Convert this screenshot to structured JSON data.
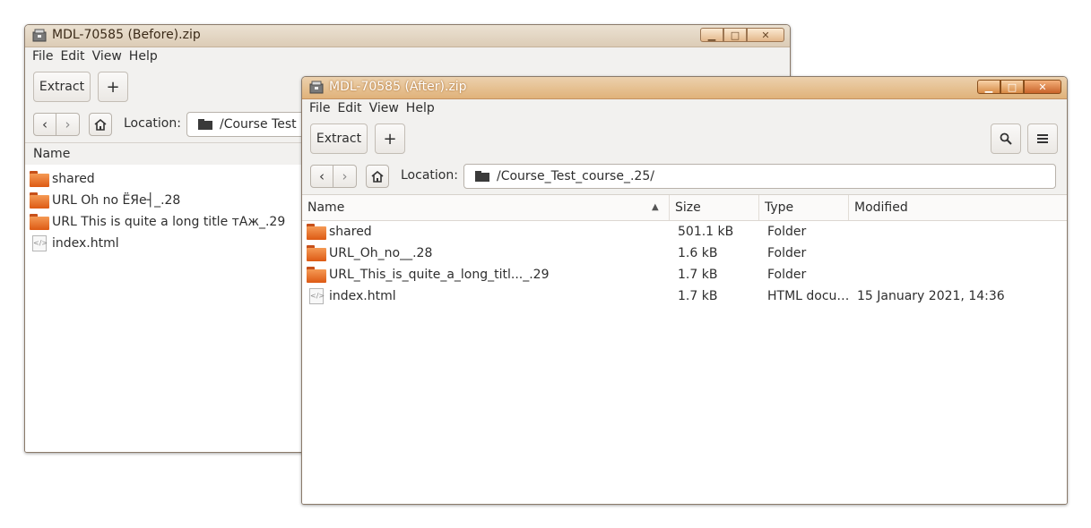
{
  "colors": {
    "accent": "#e0b27a",
    "folder": "#e0611c"
  },
  "before": {
    "title": "MDL-70585 (Before).zip",
    "menu": [
      "File",
      "Edit",
      "View",
      "Help"
    ],
    "extract_label": "Extract",
    "add_label": "+",
    "location_label": "Location:",
    "location_value": "/Course Test",
    "column_name": "Name",
    "rows": [
      {
        "name": "shared",
        "icon": "folder-icon"
      },
      {
        "name": "URL Oh no ЁЯе┤_.28",
        "icon": "folder-icon"
      },
      {
        "name": "URL This is quite a long title тАж_.29",
        "icon": "folder-icon"
      },
      {
        "name": "index.html",
        "icon": "html-file-icon"
      }
    ]
  },
  "after": {
    "title": "MDL-70585 (After).zip",
    "menu": [
      "File",
      "Edit",
      "View",
      "Help"
    ],
    "extract_label": "Extract",
    "add_label": "+",
    "location_label": "Location:",
    "location_value": "/Course_Test_course_.25/",
    "columns": {
      "name": "Name",
      "size": "Size",
      "type": "Type",
      "modified": "Modified"
    },
    "rows": [
      {
        "name": "shared",
        "size": "501.1 kB",
        "type": "Folder",
        "modified": "",
        "icon": "folder-icon"
      },
      {
        "name": "URL_Oh_no__.28",
        "size": "1.6 kB",
        "type": "Folder",
        "modified": "",
        "icon": "folder-icon"
      },
      {
        "name": "URL_This_is_quite_a_long_titl..._.29",
        "size": "1.7 kB",
        "type": "Folder",
        "modified": "",
        "icon": "folder-icon"
      },
      {
        "name": "index.html",
        "size": "1.7 kB",
        "type": "HTML docu…",
        "modified": "15 January 2021, 14:36",
        "icon": "html-file-icon"
      }
    ]
  }
}
